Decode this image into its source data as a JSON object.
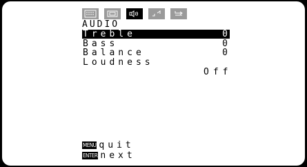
{
  "tabs": [
    {
      "icon": "picture-icon",
      "active": false
    },
    {
      "icon": "screen-icon",
      "active": false
    },
    {
      "icon": "speaker-icon",
      "active": true
    },
    {
      "icon": "setup-icon",
      "active": false
    },
    {
      "icon": "input-icon",
      "active": false
    }
  ],
  "menu": {
    "title": "AUDIO",
    "selected_index": 0,
    "items": [
      {
        "label": "Treble",
        "value": "0"
      },
      {
        "label": "Bass",
        "value": "0"
      },
      {
        "label": "Balance",
        "value": "0"
      },
      {
        "label": "Loudness",
        "value": "Off"
      }
    ]
  },
  "footer": {
    "menu_key": "MENU",
    "menu_action": "quit",
    "enter_key": "ENTER",
    "enter_action": "next"
  },
  "colors": {
    "background": "#ffffff",
    "text": "#000000",
    "highlight": "#000000",
    "tab_inactive": "#9a9a9a"
  }
}
